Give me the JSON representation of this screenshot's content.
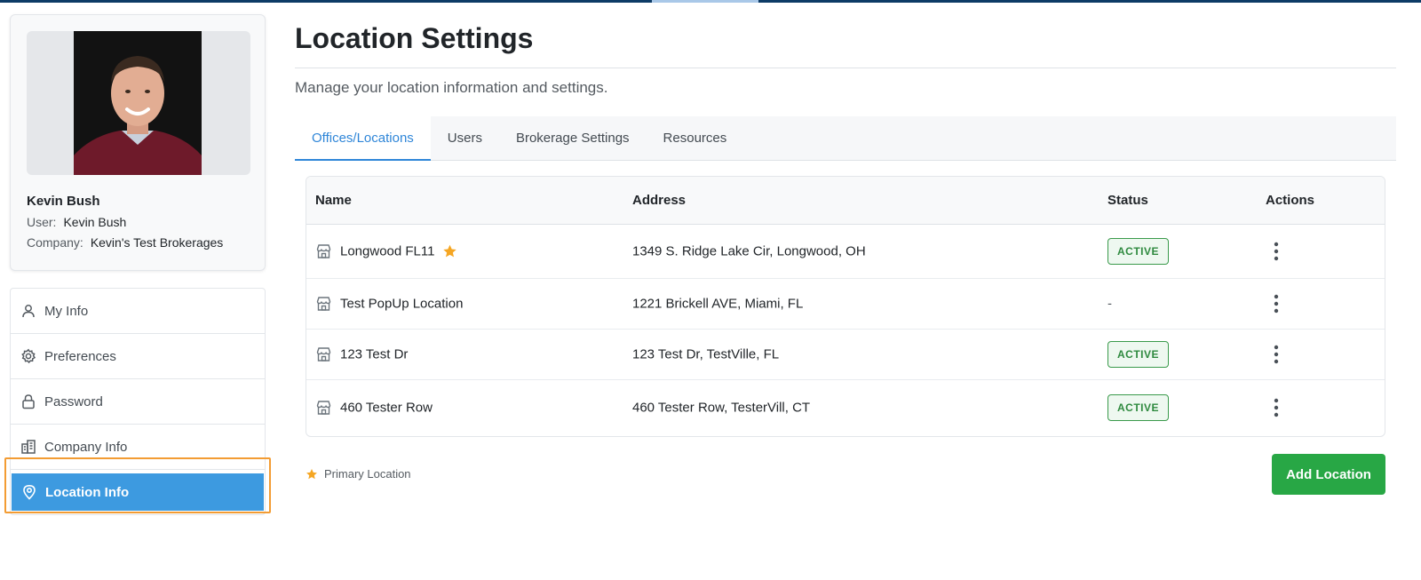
{
  "profile": {
    "name": "Kevin Bush",
    "user_label": "User:",
    "user_value": "Kevin Bush",
    "company_label": "Company:",
    "company_value": "Kevin's Test Brokerages"
  },
  "sidebar": {
    "items": [
      {
        "label": "My Info",
        "icon": "user-icon"
      },
      {
        "label": "Preferences",
        "icon": "gear-icon"
      },
      {
        "label": "Password",
        "icon": "lock-icon"
      },
      {
        "label": "Company Info",
        "icon": "building-icon"
      },
      {
        "label": "Location Info",
        "icon": "map-pin-icon",
        "active": true
      }
    ]
  },
  "page": {
    "title": "Location Settings",
    "subtitle": "Manage your location information and settings."
  },
  "tabs": [
    {
      "label": "Offices/Locations",
      "active": true
    },
    {
      "label": "Users"
    },
    {
      "label": "Brokerage Settings"
    },
    {
      "label": "Resources"
    }
  ],
  "table": {
    "headers": {
      "name": "Name",
      "address": "Address",
      "status": "Status",
      "actions": "Actions"
    },
    "rows": [
      {
        "name": "Longwood FL11",
        "primary": true,
        "address": "1349 S. Ridge Lake Cir, Longwood, OH",
        "status": "ACTIVE"
      },
      {
        "name": "Test PopUp Location",
        "primary": false,
        "address": "1221 Brickell AVE, Miami, FL",
        "status": "-"
      },
      {
        "name": "123 Test Dr",
        "primary": false,
        "address": "123 Test Dr, TestVille, FL",
        "status": "ACTIVE"
      },
      {
        "name": "460 Tester Row",
        "primary": false,
        "address": "460 Tester Row, TesterVill, CT",
        "status": "ACTIVE"
      }
    ]
  },
  "legend": {
    "label": "Primary Location"
  },
  "actions": {
    "add_label": "Add Location"
  },
  "colors": {
    "accent_blue": "#3d9ae0",
    "tab_active": "#2f86d8",
    "success_green": "#28a745",
    "star_orange": "#f5a623",
    "highlight_outline": "#f39c33"
  }
}
